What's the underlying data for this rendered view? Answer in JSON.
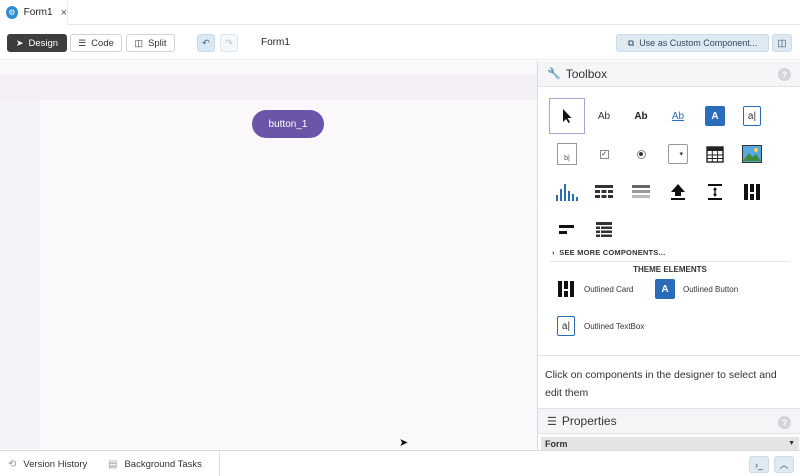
{
  "tab": {
    "title": "Form1",
    "close": "×"
  },
  "toolbar": {
    "design_label": "Design",
    "code_label": "Code",
    "split_label": "Split",
    "form_title": "Form1",
    "custom_component_label": "Use as Custom Component..."
  },
  "canvas": {
    "button_label": "button_1"
  },
  "toolbox": {
    "title": "Toolbox",
    "label_text": "Ab",
    "see_more": "SEE MORE COMPONENTS...",
    "theme_elements_title": "THEME ELEMENTS",
    "theme_items": [
      "Outlined Card",
      "Outlined Button",
      "Outlined TextBox"
    ]
  },
  "help_text": "Click on components in the designer to select and edit them",
  "properties": {
    "title": "Properties",
    "form_label": "Form"
  },
  "bottombar": {
    "version_history": "Version History",
    "background_tasks": "Background Tasks"
  },
  "colors": {
    "accent": "#6a55a8",
    "primary_blue": "#2b6cb8",
    "toolbar_dark": "#3d3d3d"
  }
}
